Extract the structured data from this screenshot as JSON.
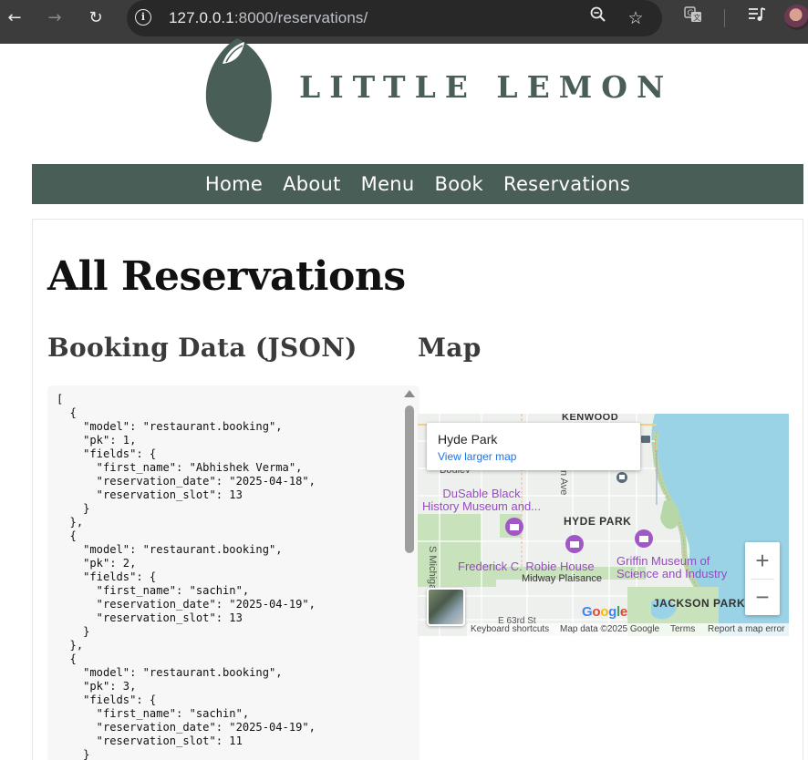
{
  "browser": {
    "url_host": "127.0.0.1",
    "url_rest": ":8000/reservations/",
    "icons": [
      "back-icon",
      "forward-icon",
      "reload-icon",
      "site-info-icon",
      "zoom-out-icon",
      "bookmark-star-icon",
      "translate-icon",
      "media-queue-icon",
      "profile-avatar"
    ]
  },
  "site": {
    "logo_text": "LITTLE LEMON",
    "brand_color": "#495e57"
  },
  "nav": {
    "items": [
      "Home",
      "About",
      "Menu",
      "Book",
      "Reservations"
    ]
  },
  "page": {
    "title": "All Reservations",
    "json_heading": "Booking Data (JSON)",
    "map_heading": "Map"
  },
  "booking_json": "[\n  {\n    \"model\": \"restaurant.booking\",\n    \"pk\": 1,\n    \"fields\": {\n      \"first_name\": \"Abhishek Verma\",\n      \"reservation_date\": \"2025-04-18\",\n      \"reservation_slot\": 13\n    }\n  },\n  {\n    \"model\": \"restaurant.booking\",\n    \"pk\": 2,\n    \"fields\": {\n      \"first_name\": \"sachin\",\n      \"reservation_date\": \"2025-04-19\",\n      \"reservation_slot\": 13\n    }\n  },\n  {\n    \"model\": \"restaurant.booking\",\n    \"pk\": 3,\n    \"fields\": {\n      \"first_name\": \"sachin\",\n      \"reservation_date\": \"2025-04-19\",\n      \"reservation_slot\": 11\n    }\n  },",
  "map": {
    "place_name": "Hyde Park",
    "view_larger": "View larger map",
    "labels": {
      "kenwood": "KENWOOD",
      "hyde_park": "HYDE PARK",
      "jackson_park": "JACKSON PARK",
      "dusable": "DuSable Black\nHistory Museum and...",
      "robie": "Frederick C. Robie House",
      "midway": "Midway Plaisance",
      "griffin": "Griffin Museum of\nScience and Industry",
      "s_michigan": "S Michiga",
      "ave": "n Ave",
      "boulevard": "Boulev",
      "street": "E 63rd St"
    },
    "zoom_in": "+",
    "zoom_out": "−",
    "google": "Google",
    "footer": {
      "shortcuts": "Keyboard shortcuts",
      "map_data": "Map data ©2025 Google",
      "terms": "Terms",
      "report": "Report a map error"
    }
  }
}
